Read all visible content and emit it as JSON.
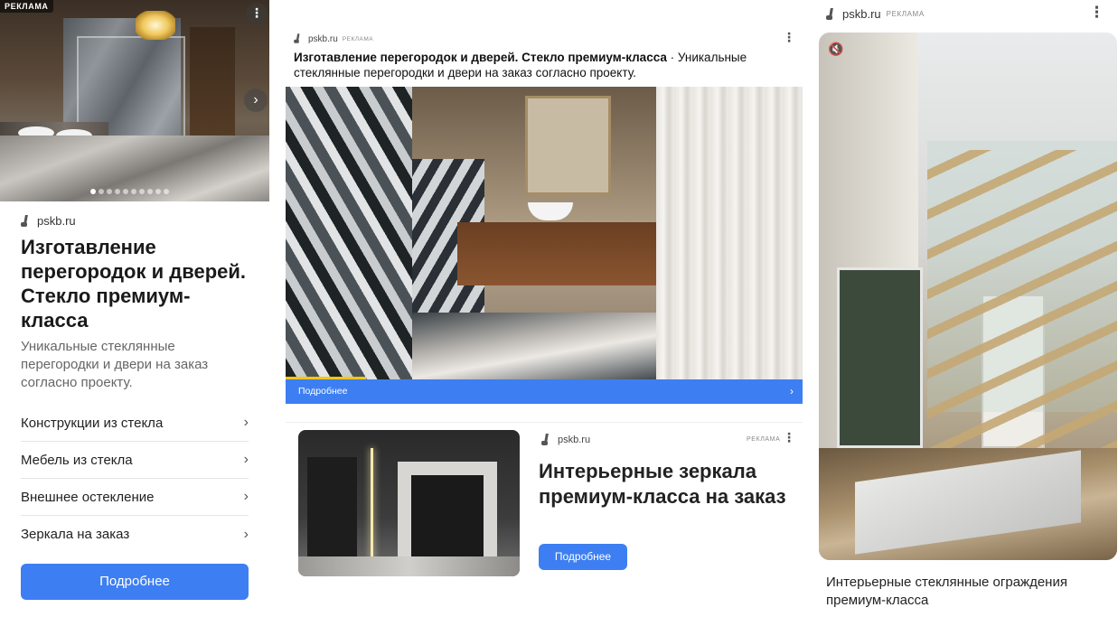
{
  "left_card": {
    "ad_label": "РЕКЛАМА",
    "menu_glyph": "⋮",
    "next_glyph": "›",
    "carousel_count": 10,
    "carousel_active": 0,
    "domain": "pskb.ru",
    "title": "Изготавление перегородок и дверей. Стекло премиум-класса",
    "description": "Уникальные стеклянные перегородки и двери на заказ согласно проекту.",
    "links": [
      {
        "label": "Конструкции из стекла"
      },
      {
        "label": "Мебель из стекла"
      },
      {
        "label": "Внешнее остекление"
      },
      {
        "label": "Зеркала на заказ"
      }
    ],
    "button_label": "Подробнее"
  },
  "center_top": {
    "domain": "pskb.ru",
    "ad_label": "РЕКЛАМА",
    "menu_glyph": "⋮",
    "title_bold": "Изготавление перегородок и дверей. Стекло премиум-класса",
    "title_rest": " · Уникальные стеклянные перегородки и двери на заказ согласно проекту.",
    "video_progress": 0.155,
    "bar_label": "Подробнее",
    "bar_chevron": "›"
  },
  "center_bottom": {
    "domain": "pskb.ru",
    "ad_label": "РЕКЛАМА",
    "menu_glyph": "⋮",
    "title": "Интерьерные зеркала премиум-класса на заказ",
    "button_label": "Подробнее"
  },
  "right_card": {
    "domain": "pskb.ru",
    "ad_label": "РЕКЛАМА",
    "menu_glyph": "⋮",
    "mute_glyph": "🔇",
    "caption": "Интерьерные стеклянные ограждения премиум-класса"
  },
  "colors": {
    "accent_blue": "#3d7ff2",
    "progress_yellow": "#f5c518"
  },
  "icons": [
    "logo-icon",
    "menu-dots-icon",
    "chevron-right-icon",
    "mute-icon"
  ]
}
